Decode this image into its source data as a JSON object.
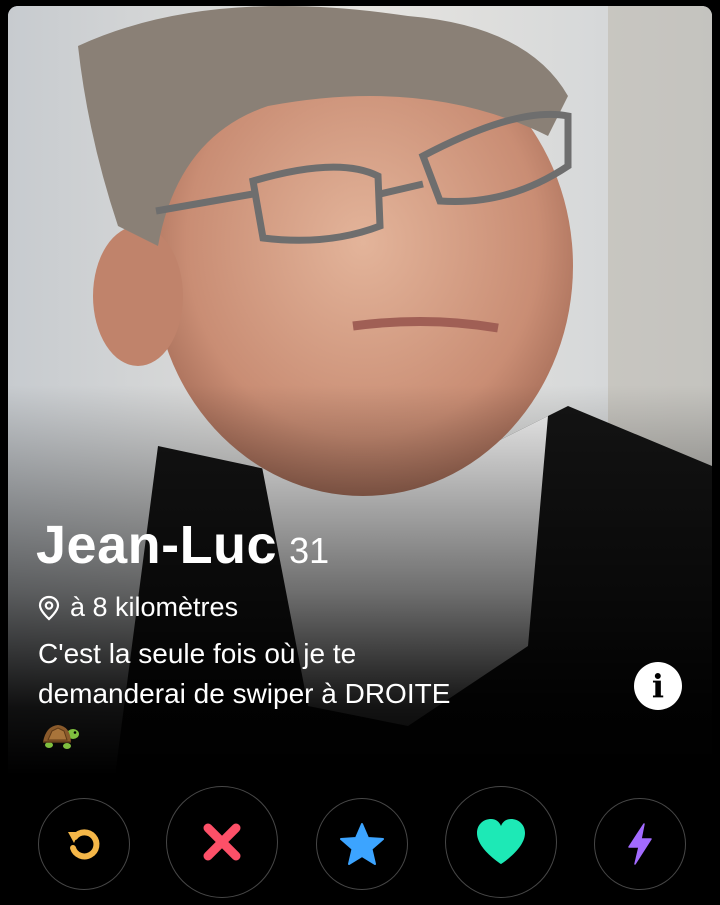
{
  "profile": {
    "name": "Jean-Luc",
    "age": "31",
    "distance": "à 8 kilomètres",
    "bio_line1": "C'est la seule fois où je te",
    "bio_line2": "demanderai de swiper à DROITE",
    "bio_emoji": "turtle-emoji"
  },
  "info_button": {
    "label": "i"
  },
  "actions": [
    {
      "id": "rewind",
      "icon": "rewind-icon",
      "color": "#f5b748"
    },
    {
      "id": "nope",
      "icon": "close-icon",
      "color": "#fd5068"
    },
    {
      "id": "super-like",
      "icon": "star-icon",
      "color": "#3ca4ff"
    },
    {
      "id": "like",
      "icon": "heart-icon",
      "color": "#1de9b6"
    },
    {
      "id": "boost",
      "icon": "lightning-icon",
      "color": "#a36bff"
    }
  ]
}
